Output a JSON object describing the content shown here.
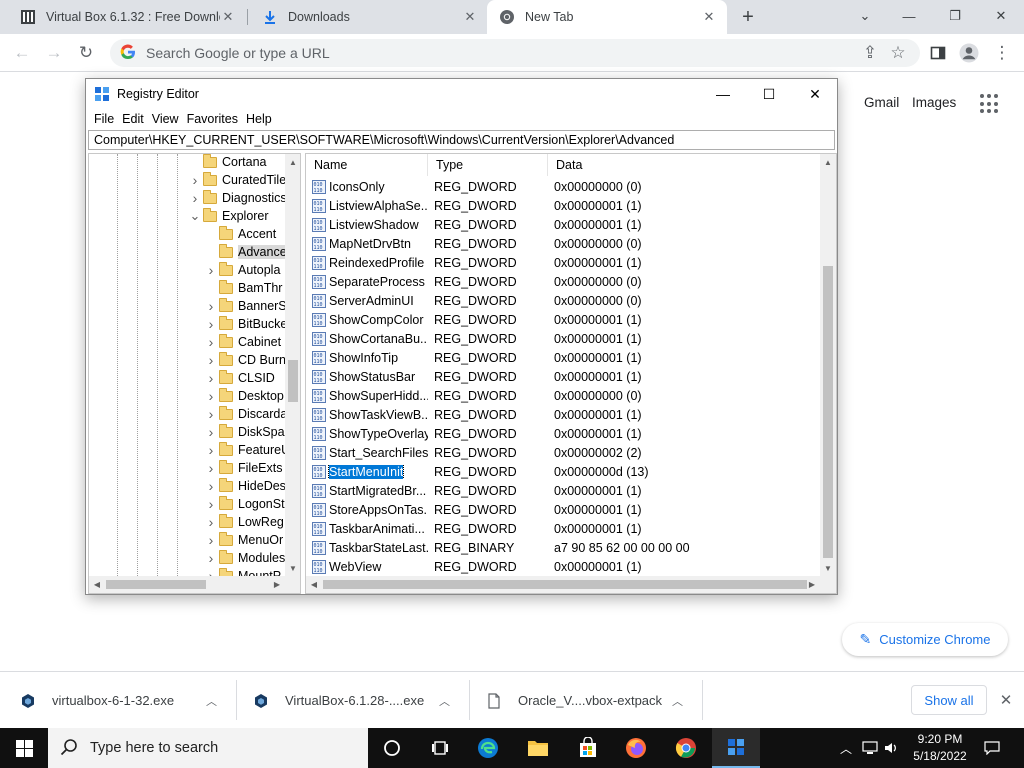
{
  "browser": {
    "tabs": [
      {
        "title": "Virtual Box 6.1.32 : Free Downlo",
        "icon": "archive-icon",
        "active": false
      },
      {
        "title": "Downloads",
        "icon": "download-icon",
        "active": false
      },
      {
        "title": "New Tab",
        "icon": "chrome-icon",
        "active": true
      }
    ],
    "newtab_label": "+",
    "omnibox": {
      "placeholder": "Search Google or type a URL"
    }
  },
  "ntp": {
    "links": {
      "gmail": "Gmail",
      "images": "Images"
    },
    "customize_label": "Customize Chrome"
  },
  "regedit": {
    "title": "Registry Editor",
    "menu": [
      "File",
      "Edit",
      "View",
      "Favorites",
      "Help"
    ],
    "address": "Computer\\HKEY_CURRENT_USER\\SOFTWARE\\Microsoft\\Windows\\CurrentVersion\\Explorer\\Advanced",
    "tree": [
      {
        "label": "Cortana",
        "level": 1,
        "expander": "none"
      },
      {
        "label": "CuratedTile",
        "level": 1,
        "expander": "collapsed"
      },
      {
        "label": "Diagnostics",
        "level": 1,
        "expander": "collapsed"
      },
      {
        "label": "Explorer",
        "level": 1,
        "expander": "expanded"
      },
      {
        "label": "Accent",
        "level": 2,
        "expander": "none"
      },
      {
        "label": "Advance",
        "level": 2,
        "expander": "none",
        "selected": true
      },
      {
        "label": "Autopla",
        "level": 2,
        "expander": "collapsed"
      },
      {
        "label": "BamThr",
        "level": 2,
        "expander": "none"
      },
      {
        "label": "BannerS",
        "level": 2,
        "expander": "collapsed"
      },
      {
        "label": "BitBucke",
        "level": 2,
        "expander": "collapsed"
      },
      {
        "label": "Cabinet",
        "level": 2,
        "expander": "collapsed"
      },
      {
        "label": "CD Burn",
        "level": 2,
        "expander": "collapsed"
      },
      {
        "label": "CLSID",
        "level": 2,
        "expander": "collapsed"
      },
      {
        "label": "Desktop",
        "level": 2,
        "expander": "collapsed"
      },
      {
        "label": "Discarda",
        "level": 2,
        "expander": "collapsed"
      },
      {
        "label": "DiskSpa",
        "level": 2,
        "expander": "collapsed"
      },
      {
        "label": "FeatureU",
        "level": 2,
        "expander": "collapsed"
      },
      {
        "label": "FileExts",
        "level": 2,
        "expander": "collapsed"
      },
      {
        "label": "HideDes",
        "level": 2,
        "expander": "collapsed"
      },
      {
        "label": "LogonSt",
        "level": 2,
        "expander": "collapsed"
      },
      {
        "label": "LowReg",
        "level": 2,
        "expander": "collapsed"
      },
      {
        "label": "MenuOr",
        "level": 2,
        "expander": "collapsed"
      },
      {
        "label": "Modules",
        "level": 2,
        "expander": "collapsed"
      },
      {
        "label": "MountP",
        "level": 2,
        "expander": "collapsed"
      }
    ],
    "columns": {
      "name": "Name",
      "type": "Type",
      "data": "Data"
    },
    "values": [
      {
        "name": "IconsOnly",
        "type": "REG_DWORD",
        "data": "0x00000000 (0)"
      },
      {
        "name": "ListviewAlphaSe...",
        "type": "REG_DWORD",
        "data": "0x00000001 (1)"
      },
      {
        "name": "ListviewShadow",
        "type": "REG_DWORD",
        "data": "0x00000001 (1)"
      },
      {
        "name": "MapNetDrvBtn",
        "type": "REG_DWORD",
        "data": "0x00000000 (0)"
      },
      {
        "name": "ReindexedProfile",
        "type": "REG_DWORD",
        "data": "0x00000001 (1)"
      },
      {
        "name": "SeparateProcess",
        "type": "REG_DWORD",
        "data": "0x00000000 (0)"
      },
      {
        "name": "ServerAdminUI",
        "type": "REG_DWORD",
        "data": "0x00000000 (0)"
      },
      {
        "name": "ShowCompColor",
        "type": "REG_DWORD",
        "data": "0x00000001 (1)"
      },
      {
        "name": "ShowCortanaBu...",
        "type": "REG_DWORD",
        "data": "0x00000001 (1)"
      },
      {
        "name": "ShowInfoTip",
        "type": "REG_DWORD",
        "data": "0x00000001 (1)"
      },
      {
        "name": "ShowStatusBar",
        "type": "REG_DWORD",
        "data": "0x00000001 (1)"
      },
      {
        "name": "ShowSuperHidd...",
        "type": "REG_DWORD",
        "data": "0x00000000 (0)"
      },
      {
        "name": "ShowTaskViewB...",
        "type": "REG_DWORD",
        "data": "0x00000001 (1)"
      },
      {
        "name": "ShowTypeOverlay",
        "type": "REG_DWORD",
        "data": "0x00000001 (1)"
      },
      {
        "name": "Start_SearchFiles",
        "type": "REG_DWORD",
        "data": "0x00000002 (2)"
      },
      {
        "name": "StartMenuInit",
        "type": "REG_DWORD",
        "data": "0x0000000d (13)",
        "selected": true
      },
      {
        "name": "StartMigratedBr...",
        "type": "REG_DWORD",
        "data": "0x00000001 (1)"
      },
      {
        "name": "StoreAppsOnTas...",
        "type": "REG_DWORD",
        "data": "0x00000001 (1)"
      },
      {
        "name": "TaskbarAnimati...",
        "type": "REG_DWORD",
        "data": "0x00000001 (1)"
      },
      {
        "name": "TaskbarStateLast...",
        "type": "REG_BINARY",
        "data": "a7 90 85 62 00 00 00 00"
      },
      {
        "name": "WebView",
        "type": "REG_DWORD",
        "data": "0x00000001 (1)"
      }
    ]
  },
  "downloads": {
    "items": [
      {
        "filename": "virtualbox-6-1-32.exe",
        "icon": "virtualbox-icon"
      },
      {
        "filename": "VirtualBox-6.1.28-....exe",
        "icon": "virtualbox-icon"
      },
      {
        "filename": "Oracle_V....vbox-extpack",
        "icon": "file-icon"
      }
    ],
    "show_all_label": "Show all"
  },
  "taskbar": {
    "search_placeholder": "Type here to search",
    "apps": [
      "cortana-icon",
      "task-view-icon",
      "edge-icon",
      "file-explorer-icon",
      "store-icon",
      "firefox-icon",
      "chrome-icon",
      "regedit-icon"
    ],
    "time": "9:20 PM",
    "date": "5/18/2022"
  },
  "colors": {
    "selection_blue": "#0078d7",
    "chrome_link_blue": "#1a73e8",
    "taskbar_bg": "#101010",
    "folder_yellow": "#f5d57a"
  }
}
